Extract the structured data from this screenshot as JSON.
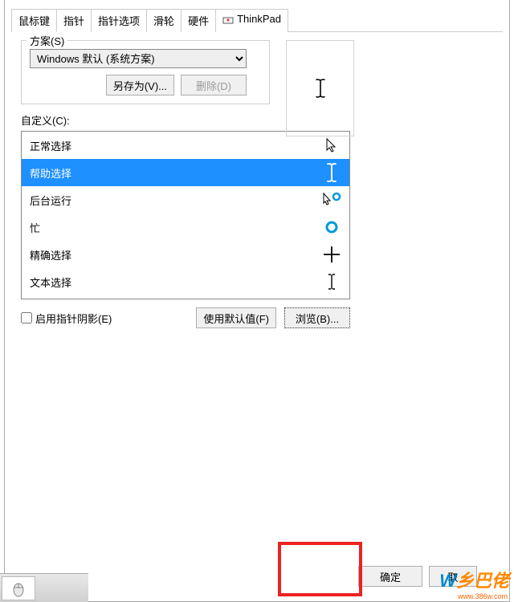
{
  "tabs": {
    "t0": "鼠标键",
    "t1": "指针",
    "t2": "指针选项",
    "t3": "滑轮",
    "t4": "硬件",
    "t5": "ThinkPad"
  },
  "scheme": {
    "group_label": "方案(S)",
    "selected": "Windows 默认 (系统方案)",
    "save_as": "另存为(V)...",
    "delete": "删除(D)"
  },
  "customize": {
    "label": "自定义(C):",
    "items": [
      {
        "label": "正常选择",
        "icon": "arrow"
      },
      {
        "label": "帮助选择",
        "icon": "ibeam",
        "selected": true
      },
      {
        "label": "后台运行",
        "icon": "arrow-ring"
      },
      {
        "label": "忙",
        "icon": "ring"
      },
      {
        "label": "精确选择",
        "icon": "cross"
      },
      {
        "label": "文本选择",
        "icon": "ibeam-thin"
      }
    ]
  },
  "shadow": {
    "label": "启用指针阴影(E)",
    "checked": false
  },
  "defaults_btn": "使用默认值(F)",
  "browse_btn": "浏览(B)...",
  "ok_btn": "确定",
  "cancel_btn": "取",
  "watermark": {
    "main": "乡巴佬",
    "url": "www.386w.com"
  }
}
